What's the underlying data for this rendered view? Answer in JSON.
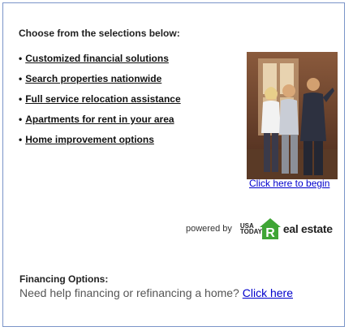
{
  "heading": "Choose from the selections below:",
  "links": [
    {
      "bullet": "•",
      "label": "Customized financial solutions"
    },
    {
      "bullet": "•",
      "label": "Search properties nationwide"
    },
    {
      "bullet": "•",
      "label": "Full service relocation assistance"
    },
    {
      "bullet": "•",
      "label": "Apartments for rent in your area"
    },
    {
      "bullet": "•",
      "label": "Home improvement options"
    }
  ],
  "photo_link": "Click here to begin",
  "powered": {
    "prefix": "powered by",
    "brand_small": "USA TODAY",
    "brand_letter": "R",
    "brand_rest": "eal estate"
  },
  "financing": {
    "title": "Financing Options:",
    "text": "Need help financing or refinancing a home? ",
    "link": "Click here"
  },
  "colors": {
    "border": "#7a94c8",
    "link": "#0000cc",
    "brand_green": "#3fa535"
  }
}
